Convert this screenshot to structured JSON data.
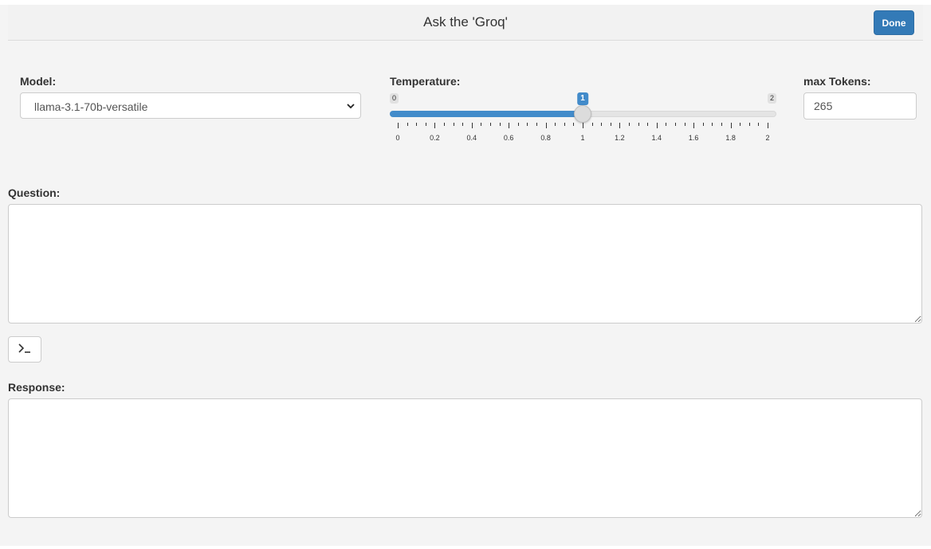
{
  "header": {
    "title": "Ask the 'Groq'",
    "done_label": "Done"
  },
  "model": {
    "label": "Model:",
    "selected": "llama-3.1-70b-versatile"
  },
  "temperature": {
    "label": "Temperature:",
    "min": 0,
    "max": 2,
    "value": 1,
    "min_label": "0",
    "max_label": "2",
    "value_label": "1",
    "ticks": [
      "0",
      "0.2",
      "0.4",
      "0.6",
      "0.8",
      "1",
      "1.2",
      "1.4",
      "1.6",
      "1.8",
      "2"
    ]
  },
  "max_tokens": {
    "label": "max Tokens:",
    "value": "265"
  },
  "question": {
    "label": "Question:",
    "value": ""
  },
  "run_button": {
    "icon": "terminal-icon"
  },
  "response": {
    "label": "Response:",
    "value": ""
  },
  "colors": {
    "accent": "#428bca",
    "done_button": "#337ab7",
    "background": "#f4f4f4"
  }
}
